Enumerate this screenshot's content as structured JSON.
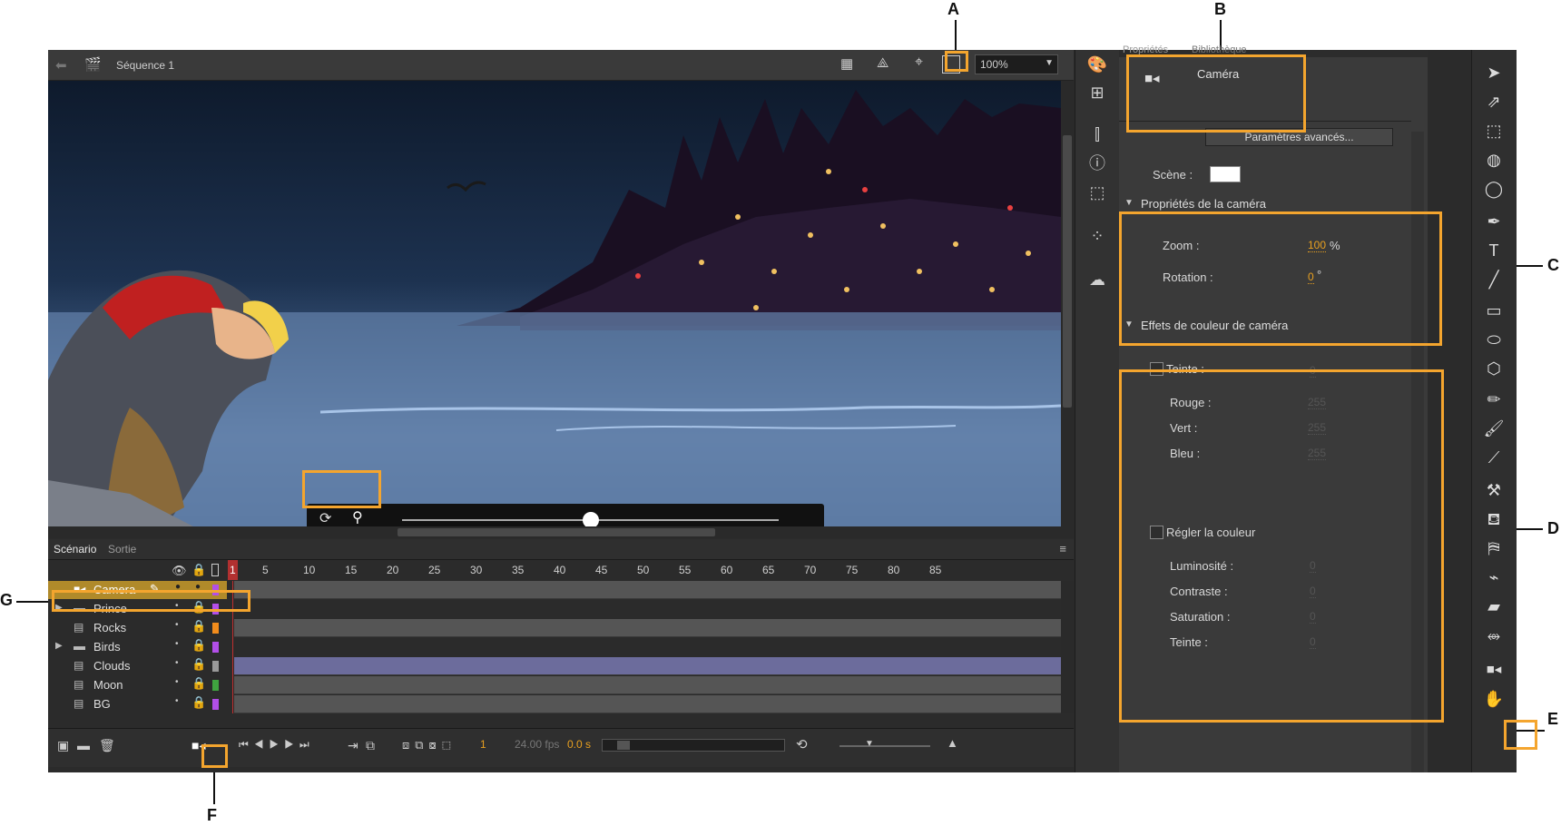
{
  "callouts": {
    "a": "A",
    "b": "B",
    "c": "C",
    "d": "D",
    "e": "E",
    "f": "F",
    "g": "G"
  },
  "stage_toolbar": {
    "sequence": "Séquence 1",
    "zoom": "100%"
  },
  "timeline": {
    "tabs": [
      "Scénario",
      "Sortie"
    ],
    "ruler": [
      "1",
      "5",
      "10",
      "15",
      "20",
      "25",
      "30",
      "35",
      "40",
      "45",
      "50",
      "55",
      "60",
      "65",
      "70",
      "75",
      "80",
      "85"
    ],
    "layers": [
      {
        "name": "Camera",
        "color": "#b24fe8",
        "selected": true
      },
      {
        "name": "Prince",
        "color": "#b24fe8"
      },
      {
        "name": "Rocks",
        "color": "#f28c1c"
      },
      {
        "name": "Birds",
        "color": "#b24fe8"
      },
      {
        "name": "Clouds",
        "color": "#9a9a9a"
      },
      {
        "name": "Moon",
        "color": "#3fa33f"
      },
      {
        "name": "BG",
        "color": "#b24fe8"
      }
    ],
    "frame": "1",
    "fps": "24.00 fps",
    "time": "0.0 s"
  },
  "props": {
    "tabs": [
      "Propriétés",
      "Bibliothèque"
    ],
    "object": "Caméra",
    "advanced": "Paramètres avancés...",
    "scene_label": "Scène :",
    "camera_section": "Propriétés de la caméra",
    "zoom_label": "Zoom :",
    "zoom_value": "100",
    "zoom_unit": "%",
    "rotation_label": "Rotation :",
    "rotation_value": "0",
    "rotation_unit": "°",
    "color_section": "Effets de couleur de caméra",
    "tint_label": "Teinte :",
    "tint_value": "0",
    "red_label": "Rouge :",
    "red_value": "255",
    "green_label": "Vert :",
    "green_value": "255",
    "blue_label": "Bleu :",
    "blue_value": "255",
    "adjust_label": "Régler la couleur",
    "brightness_label": "Luminosité :",
    "brightness_value": "0",
    "contrast_label": "Contraste :",
    "contrast_value": "0",
    "saturation_label": "Saturation :",
    "saturation_value": "0",
    "hue_label": "Teinte :",
    "hue_value": "0"
  },
  "accent": "#f4a52e"
}
